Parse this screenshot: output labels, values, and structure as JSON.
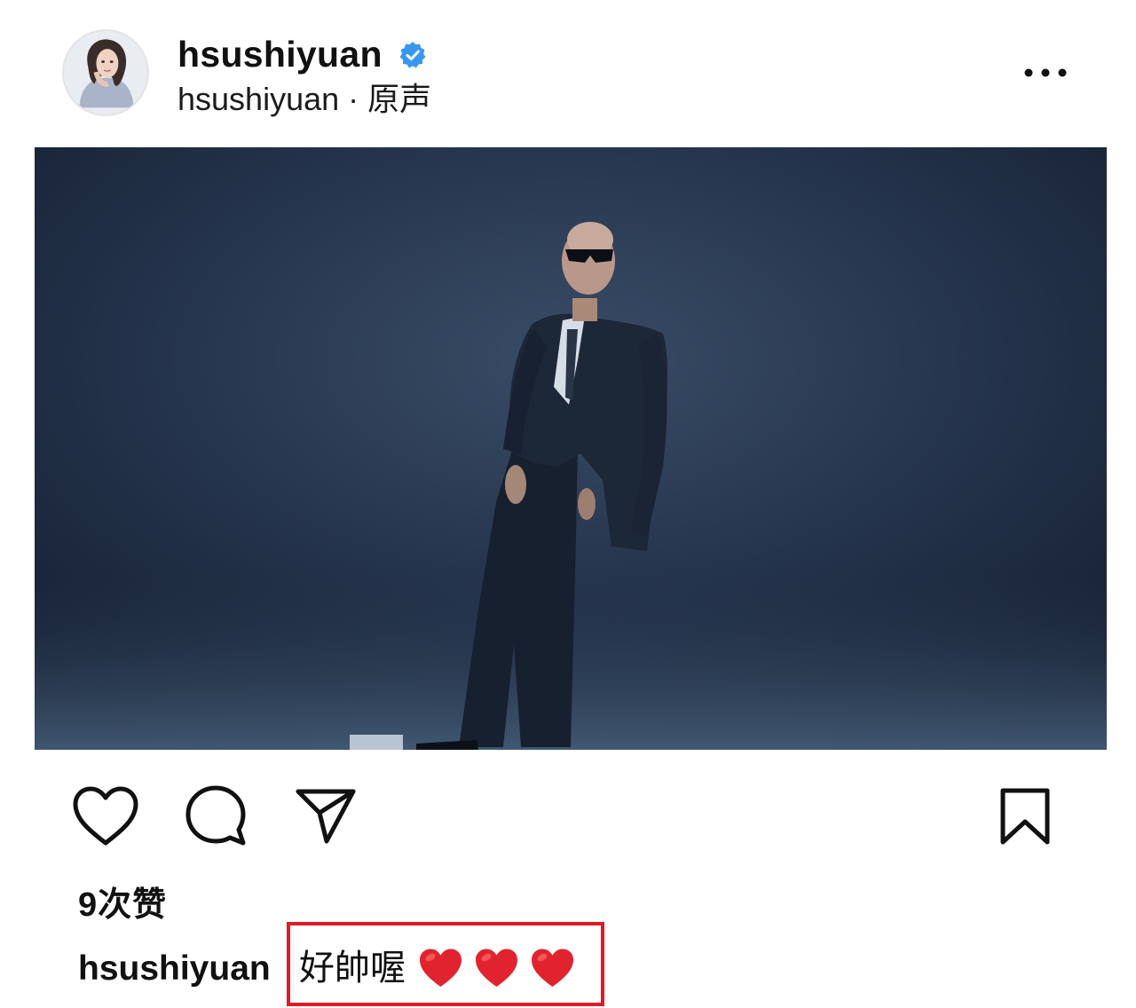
{
  "post": {
    "author": {
      "username": "hsushiyuan",
      "verified": true,
      "audio": "hsushiyuan · 原声"
    },
    "likes": "9次赞",
    "caption": {
      "username": "hsushiyuan",
      "text": "好帥喔",
      "emoji": [
        "heart",
        "heart",
        "heart"
      ]
    }
  },
  "icons": {
    "more": "more-dots-icon",
    "like": "heart-outline-icon",
    "comment": "comment-bubble-icon",
    "share": "paper-plane-icon",
    "save": "bookmark-icon",
    "verified": "verified-badge-icon"
  },
  "colors": {
    "verified_blue": "#3897f0",
    "highlight_red": "#e11a25",
    "heart_red": "#e0232e"
  }
}
